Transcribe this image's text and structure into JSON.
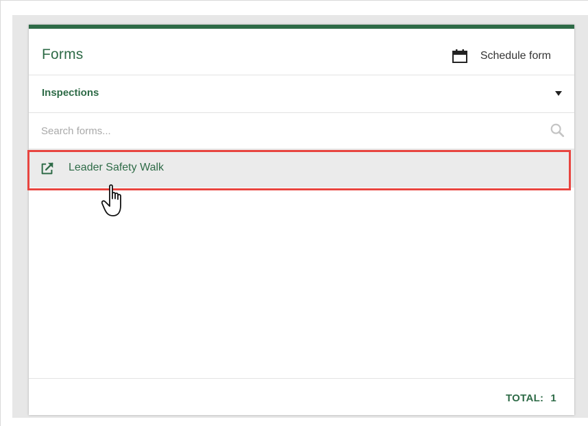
{
  "panel": {
    "title": "Forms",
    "accent_color": "#2e6b47",
    "schedule_label": "Schedule form",
    "schedule_icon": "calendar-icon"
  },
  "category": {
    "selected": "Inspections",
    "dropdown_icon": "caret-down-icon"
  },
  "search": {
    "placeholder": "Search forms...",
    "value": "",
    "icon": "search-icon"
  },
  "forms": [
    {
      "label": "Leader Safety Walk",
      "icon": "external-link-icon",
      "hovered": true
    }
  ],
  "footer": {
    "total_label": "TOTAL:",
    "total_value": "1"
  },
  "highlight_color": "#e8443f"
}
